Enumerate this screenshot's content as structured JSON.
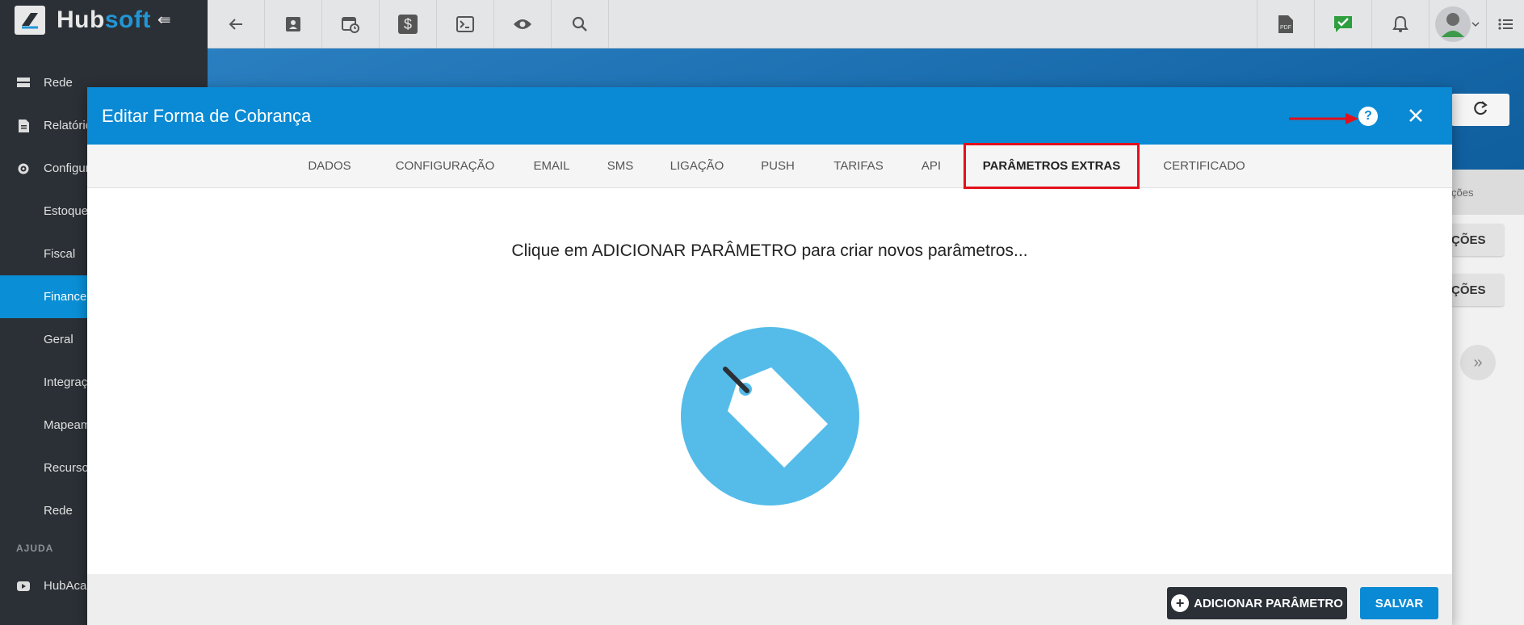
{
  "brand": {
    "name_a": "Hub",
    "name_b": "soft",
    "collapse_icon": "collapse-left-icon"
  },
  "sidebar": {
    "items": [
      {
        "label": "Rede",
        "icon": "server-icon"
      },
      {
        "label": "Relatórios",
        "icon": "document-icon"
      },
      {
        "label": "Configurações",
        "icon": "gear-icon"
      },
      {
        "label": "Estoque"
      },
      {
        "label": "Fiscal"
      },
      {
        "label": "Financeiro"
      },
      {
        "label": "Geral"
      },
      {
        "label": "Integrações"
      },
      {
        "label": "Mapeamento"
      },
      {
        "label": "Recursos"
      },
      {
        "label": "Rede"
      }
    ],
    "section_help": "AJUDA",
    "help_item": {
      "label": "HubAcademy",
      "icon": "youtube-icon"
    }
  },
  "topbar": {
    "buttons": [
      "back-arrow-icon",
      "contact-card-icon",
      "calendar-clock-icon",
      "dollar-icon",
      "terminal-icon",
      "eye-icon",
      "search-icon"
    ],
    "right_buttons": [
      "pdf-icon",
      "checked-message-icon",
      "bell-icon",
      "user-avatar",
      "list-icon"
    ]
  },
  "background_page": {
    "tab_partial": "ções",
    "btn1_partial": "ÇÕES",
    "btn2_partial": "ÇÕES"
  },
  "modal": {
    "title": "Editar Forma de Cobrança",
    "tabs": [
      "DADOS",
      "CONFIGURAÇÃO",
      "EMAIL",
      "SMS",
      "LIGAÇÃO",
      "PUSH",
      "TARIFAS",
      "API",
      "PARÂMETROS EXTRAS",
      "CERTIFICADO"
    ],
    "active_tab": "PARÂMETROS EXTRAS",
    "empty_message": "Clique em ADICIONAR PARÂMETRO para criar novos parâmetros...",
    "add_button": "ADICIONAR PARÂMETRO",
    "save_button": "SALVAR"
  },
  "colors": {
    "primary": "#0a8ad4",
    "sidebar": "#2b3036",
    "highlight": "#e2101b",
    "tag_circle": "#55bce9"
  }
}
